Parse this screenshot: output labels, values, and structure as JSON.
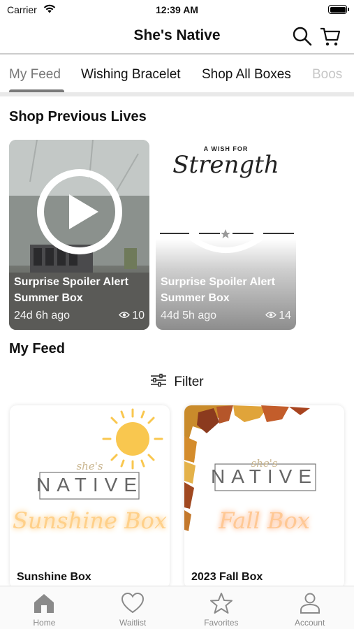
{
  "status_bar": {
    "carrier": "Carrier",
    "time": "12:39 AM"
  },
  "header": {
    "title": "She's Native",
    "search_icon": "search-icon",
    "cart_icon": "cart-icon"
  },
  "tabs": [
    {
      "label": "My Feed",
      "active": true
    },
    {
      "label": "Wishing Bracelet"
    },
    {
      "label": "Shop All Boxes"
    },
    {
      "label": "Boos"
    }
  ],
  "previous_lives": {
    "title": "Shop Previous Lives",
    "items": [
      {
        "title": "Surprise Spoiler Alert Summer Box",
        "ago": "24d 6h ago",
        "views": "10"
      },
      {
        "title": "Surprise Spoiler Alert Summer Box",
        "ago": "44d 5h ago",
        "views": "14",
        "artwork_text": "A WISH FOR",
        "artwork_script": "Strength"
      }
    ]
  },
  "feed": {
    "title": "My Feed",
    "filter_label": "Filter",
    "products": [
      {
        "name": "Sunshine Box",
        "logo_top": "she's",
        "logo": "NATIVE",
        "script": "Sunshine Box"
      },
      {
        "name": "2023 Fall Box",
        "logo_top": "she's",
        "logo": "NATIVE",
        "script": "Fall Box"
      }
    ]
  },
  "bottom_nav": [
    {
      "label": "Home",
      "icon": "home-icon"
    },
    {
      "label": "Waitlist",
      "icon": "heart-icon"
    },
    {
      "label": "Favorites",
      "icon": "star-icon"
    },
    {
      "label": "Account",
      "icon": "account-icon"
    }
  ],
  "colors": {
    "accent": "#111111",
    "muted": "#8a8a8a",
    "sun": "#f9c74f",
    "neon_orange": "#ffd089"
  }
}
